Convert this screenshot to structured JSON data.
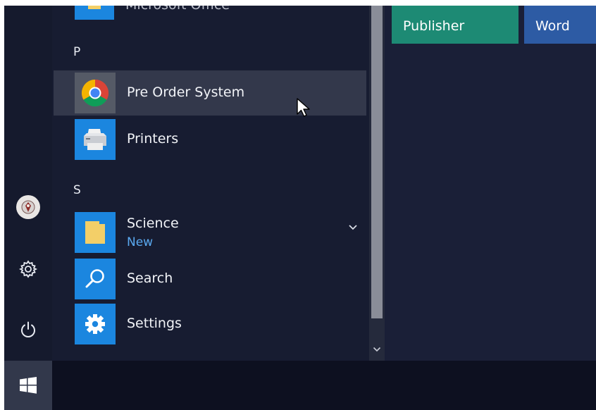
{
  "app_list": {
    "top_cut": {
      "label": "Microsoft Office"
    },
    "section_p": "P",
    "section_s": "S",
    "items": [
      {
        "label": "Pre Order System",
        "icon": "chrome-icon",
        "hover": true
      },
      {
        "label": "Printers",
        "icon": "printer-icon"
      },
      {
        "label": "Science",
        "sub": "New",
        "icon": "folder-icon",
        "expandable": true
      },
      {
        "label": "Search",
        "icon": "search-icon"
      },
      {
        "label": "Settings",
        "icon": "gear-icon"
      }
    ]
  },
  "tiles": [
    {
      "label": "Publisher",
      "color": "#1d8a74"
    },
    {
      "label": "Word",
      "color": "#2d5ba4"
    }
  ],
  "rail": [
    "user-avatar",
    "settings-icon",
    "power-icon"
  ],
  "taskbar": {
    "start_icon": "windows-logo-icon"
  },
  "colors": {
    "accent": "#1b86df",
    "background": "#171b30",
    "hover": "#33384b",
    "new_badge": "#5aa9f0"
  }
}
